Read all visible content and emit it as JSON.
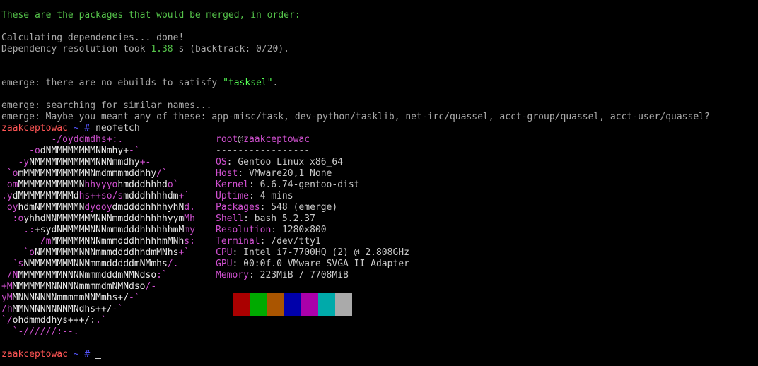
{
  "emerge": {
    "merge_header": "These are the packages that would be merged, in order:",
    "calc": "Calculating dependencies... done!",
    "dep_prefix": "Dependency resolution took ",
    "dep_time": "1.38",
    "dep_suffix": " s (backtrack: 0/20).",
    "no_ebuild_prefix": "emerge: there are no ebuilds to satisfy ",
    "no_ebuild_pkg": "\"tasksel\"",
    "no_ebuild_suffix": ".",
    "searching": "emerge: searching for similar names...",
    "maybe": "emerge: Maybe you meant any of these: app-misc/task, dev-python/tasklib, net-irc/quassel, acct-group/quassel, acct-user/quassel?"
  },
  "prompt": {
    "host": "zaakceptowac",
    "dir": "~",
    "symbol": "#",
    "command": "neofetch"
  },
  "logo_lines": [
    [
      [
        "m",
        "         -/oyddmdhs+:."
      ]
    ],
    [
      [
        "m",
        "     -o"
      ],
      [
        "w",
        "dNMMMMMMMMNNmhy+"
      ],
      [
        "m",
        "-`"
      ]
    ],
    [
      [
        "m",
        "   -y"
      ],
      [
        "w",
        "NMMMMMMMMMMMNNNmmdhy"
      ],
      [
        "m",
        "+-"
      ]
    ],
    [
      [
        "m",
        " `o"
      ],
      [
        "w",
        "mMMMMMMMMMMMMNmdmmmmddhhy"
      ],
      [
        "m",
        "/`"
      ]
    ],
    [
      [
        "m",
        " om"
      ],
      [
        "w",
        "MMMMMMMMMMMN"
      ],
      [
        "m",
        "hhyyyo"
      ],
      [
        "w",
        "hmdddhhhd"
      ],
      [
        "m",
        "o`"
      ]
    ],
    [
      [
        "m",
        ".y"
      ],
      [
        "w",
        "dMMMMMMMMMMd"
      ],
      [
        "m",
        "hs++so/s"
      ],
      [
        "w",
        "mdddhhhhdm"
      ],
      [
        "m",
        "+`"
      ]
    ],
    [
      [
        "m",
        " oy"
      ],
      [
        "w",
        "hdmNMMMMMMMN"
      ],
      [
        "m",
        "dyooy"
      ],
      [
        "w",
        "dmddddhhhhyhN"
      ],
      [
        "m",
        "d."
      ]
    ],
    [
      [
        "m",
        "  :o"
      ],
      [
        "w",
        "yhhdNNMMMMMMMNNNmmdddhhhhhyym"
      ],
      [
        "m",
        "Mh"
      ]
    ],
    [
      [
        "m",
        "    .:"
      ],
      [
        "w",
        "+sydNMMMMMNNNmmmdddhhhhhhmM"
      ],
      [
        "m",
        "my"
      ]
    ],
    [
      [
        "m",
        "       /m"
      ],
      [
        "w",
        "MMMMMMNNNmmmdddhhhhhmMNh"
      ],
      [
        "m",
        "s:"
      ]
    ],
    [
      [
        "m",
        "    `o"
      ],
      [
        "w",
        "NMMMMMMMNNNmmmddddhhdmMNhs"
      ],
      [
        "m",
        "+`"
      ]
    ],
    [
      [
        "m",
        "  `s"
      ],
      [
        "w",
        "NMMMMMMMMNNNmmmdddddmNMmhs"
      ],
      [
        "m",
        "/."
      ]
    ],
    [
      [
        "m",
        " /N"
      ],
      [
        "w",
        "MMMMMMMMNNNNmmmdddmNMNdso"
      ],
      [
        "m",
        ":`"
      ]
    ],
    [
      [
        "m",
        "+M"
      ],
      [
        "w",
        "MMMMMMMNNNNNmmmmdmNMNdso"
      ],
      [
        "m",
        "/-"
      ]
    ],
    [
      [
        "m",
        "yM"
      ],
      [
        "w",
        "MNNNNNNNmmmmmNNMmhs+/"
      ],
      [
        "m",
        "-`"
      ]
    ],
    [
      [
        "m",
        "/h"
      ],
      [
        "w",
        "MMNNNNNNNNMNdhs++/"
      ],
      [
        "m",
        "-`"
      ]
    ],
    [
      [
        "m",
        "`/"
      ],
      [
        "w",
        "ohdmmddhys+++/:"
      ],
      [
        "m",
        ".`"
      ]
    ],
    [
      [
        "m",
        "  `-//////:--."
      ]
    ]
  ],
  "neofetch": {
    "user": "root",
    "at": "@",
    "host": "zaakceptowac",
    "separator": "-----------------",
    "rows": [
      {
        "key": "OS",
        "value": "Gentoo Linux x86_64"
      },
      {
        "key": "Host",
        "value": "VMware20,1 None"
      },
      {
        "key": "Kernel",
        "value": "6.6.74-gentoo-dist"
      },
      {
        "key": "Uptime",
        "value": "4 mins"
      },
      {
        "key": "Packages",
        "value": "548 (emerge)"
      },
      {
        "key": "Shell",
        "value": "bash 5.2.37"
      },
      {
        "key": "Resolution",
        "value": "1280x800"
      },
      {
        "key": "Terminal",
        "value": "/dev/tty1"
      },
      {
        "key": "CPU",
        "value": "Intel i7-7700HQ (2) @ 2.808GHz"
      },
      {
        "key": "GPU",
        "value": "00:0f.0 VMware SVGA II Adapter"
      },
      {
        "key": "Memory",
        "value": "223MiB / 7708MiB"
      }
    ],
    "palette": [
      "#000000",
      "#aa0000",
      "#00aa00",
      "#aa5500",
      "#0000aa",
      "#aa00aa",
      "#00aaaa",
      "#aaaaaa"
    ]
  },
  "prompt2": {
    "host": "zaakceptowac",
    "dir": "~",
    "symbol": "#"
  }
}
